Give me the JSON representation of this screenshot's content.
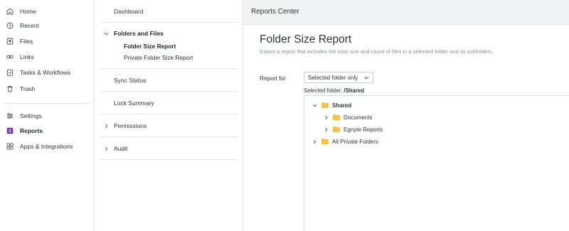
{
  "nav": {
    "items": [
      {
        "label": "Home",
        "icon": "home-icon"
      },
      {
        "label": "Recent",
        "icon": "clock-icon"
      },
      {
        "label": "Files",
        "icon": "files-icon"
      },
      {
        "label": "Links",
        "icon": "link-icon"
      },
      {
        "label": "Tasks & Workflows",
        "icon": "tasks-icon"
      },
      {
        "label": "Trash",
        "icon": "trash-icon"
      },
      {
        "label": "Settings",
        "icon": "sliders-icon"
      },
      {
        "label": "Reports",
        "icon": "reports-icon",
        "active": true
      },
      {
        "label": "Apps & Integrations",
        "icon": "apps-icon"
      }
    ]
  },
  "menu": {
    "dashboard": "Dashboard",
    "folders_and_files": "Folders and Files",
    "folder_size_report": "Folder Size Report",
    "private_folder_size_report": "Private Folder Size Report",
    "sync_status": "Sync Status",
    "lock_summary": "Lock Summary",
    "permissions": "Permissions",
    "audit": "Audit"
  },
  "main": {
    "header": "Reports Center",
    "title": "Folder Size Report",
    "description": "Export a report that includes the total size and count of files in a selected folder and its subfolders.",
    "report_for_label": "Report for",
    "report_for_value": "Selected folder only",
    "selected_folder_label": "Selected folder:",
    "selected_folder_value": "/Shared",
    "tree": [
      {
        "label": "Shared",
        "expanded": true,
        "bold": true
      },
      {
        "label": "Documents",
        "expanded": false
      },
      {
        "label": "Egnyte Reports",
        "expanded": false
      },
      {
        "label": "All Private Folders",
        "expanded": false
      }
    ]
  },
  "colors": {
    "accent": "#6b2fa3",
    "folder": "#f6c343",
    "annotation_arrow": "#e5331f"
  }
}
